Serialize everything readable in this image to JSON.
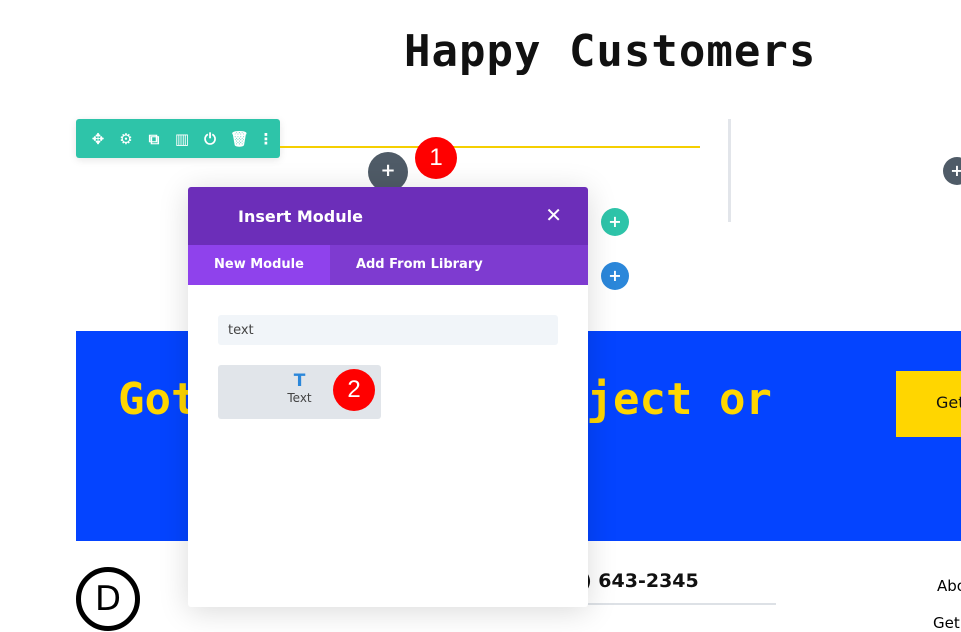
{
  "page": {
    "title": "Happy Customers",
    "banner_left": "Got",
    "banner_right": "oject or",
    "banner_button": "Get",
    "phone": ") 643-2345",
    "footer_links": [
      "Abo",
      "Get"
    ]
  },
  "toolbar": {
    "icons": [
      "move-icon",
      "gear-icon",
      "duplicate-icon",
      "columns-icon",
      "power-icon",
      "trash-icon",
      "more-icon"
    ]
  },
  "badges": [
    "1",
    "2"
  ],
  "modal": {
    "title": "Insert Module",
    "tabs": [
      {
        "label": "New Module",
        "active": true
      },
      {
        "label": "Add From Library",
        "active": false
      }
    ],
    "search_value": "text",
    "results": [
      {
        "icon": "T",
        "label": "Text"
      }
    ]
  },
  "colors": {
    "toolbar": "#2ec4a9",
    "modal_header": "#6c2eb9",
    "banner": "#0444ff",
    "accent": "#ffd600"
  }
}
